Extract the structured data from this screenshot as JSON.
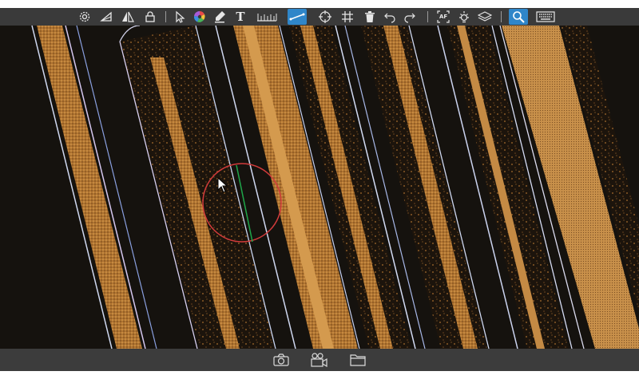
{
  "toolbar": {
    "items": [
      {
        "icon": "gear-icon",
        "tooltip": ""
      },
      {
        "icon": "flip-vertical-icon"
      },
      {
        "icon": "flip-horizontal-icon"
      },
      {
        "icon": "lock-icon"
      },
      {
        "icon": "pointer-icon"
      },
      {
        "icon": "color-wheel-icon"
      },
      {
        "icon": "pen-icon"
      },
      {
        "icon": "text-icon",
        "label": "T"
      },
      {
        "icon": "ruler-icon"
      },
      {
        "icon": "measure-line-icon",
        "active": true
      },
      {
        "icon": "crosshair-icon"
      },
      {
        "icon": "grid-icon"
      },
      {
        "icon": "trash-icon"
      },
      {
        "icon": "undo-icon"
      },
      {
        "icon": "redo-icon"
      },
      {
        "icon": "autofocus-icon",
        "label": "AF"
      },
      {
        "icon": "brightness-icon"
      },
      {
        "icon": "layers-icon"
      },
      {
        "icon": "zoom-icon",
        "active": true
      },
      {
        "icon": "keyboard-icon"
      }
    ]
  },
  "bottombar": {
    "items": [
      {
        "icon": "camera-icon"
      },
      {
        "icon": "video-camera-icon"
      },
      {
        "icon": "folder-icon"
      }
    ]
  },
  "colors": {
    "toolbar_bg": "#3a3a3a",
    "active": "#2f86c9",
    "viewport_bg": "#15120e",
    "stripe_gold": "#c98a3a",
    "measure_circle": "#d23b3b",
    "measure_line": "#1fa64a"
  }
}
